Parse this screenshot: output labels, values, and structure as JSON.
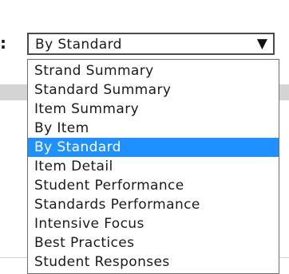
{
  "label_colon": ":",
  "select": {
    "value": "By Standard",
    "arrow_icon": "triangle-down-icon"
  },
  "options": [
    "Strand Summary",
    "Standard Summary",
    "Item Summary",
    "By Item",
    "By Standard",
    "Item Detail",
    "Student Performance",
    "Standards Performance",
    "Intensive Focus",
    "Best Practices",
    "Student Responses"
  ],
  "selected_option": "By Standard",
  "colors": {
    "highlight": "#1E90FF",
    "band": "#D4D4D4"
  }
}
